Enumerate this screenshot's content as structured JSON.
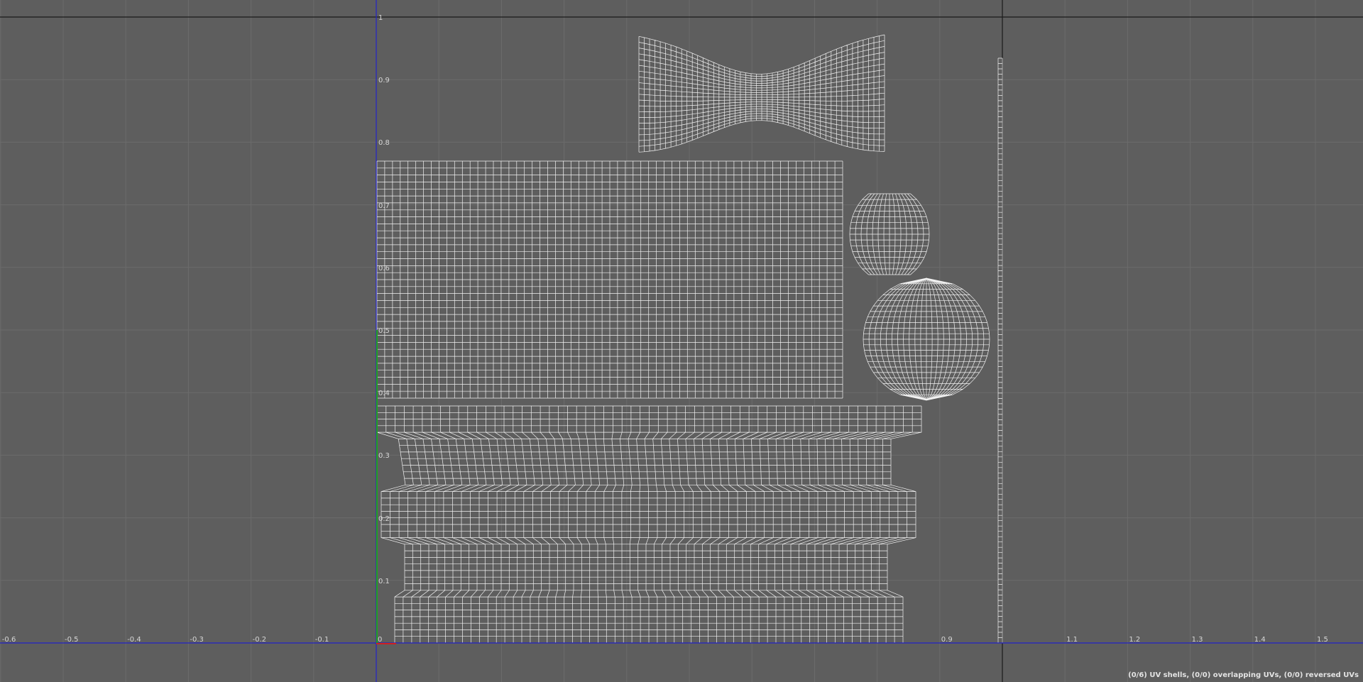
{
  "viewport": {
    "u_labels": [
      "-0.6",
      "-0.5",
      "-0.4",
      "-0.3",
      "-0.2",
      "-0.1",
      "0",
      "0.9",
      "1.1",
      "1.2",
      "1.3",
      "1.4",
      "1.5"
    ],
    "v_labels": [
      "1",
      "0.9",
      "0.8",
      "0.7",
      "0.6",
      "0.5",
      "0.4",
      "0.3",
      "0.2",
      "0.1"
    ],
    "colors": {
      "background": "#5e5e5e",
      "grid": "#6b6b6b",
      "frame": "#1a1a1a",
      "u_axis": "#2323c8",
      "v_axis": "#2323c8",
      "v_highlight": "#22a022",
      "u_highlight": "#d02020",
      "wireframe": "#f2f2f2"
    }
  },
  "uv_shells": [
    {
      "name": "curved-bone-shell"
    },
    {
      "name": "large-rectangle-shell"
    },
    {
      "name": "small-sphere-shell"
    },
    {
      "name": "large-sphere-shell"
    },
    {
      "name": "cylinder-body-shell"
    },
    {
      "name": "thin-strip-shell"
    }
  ],
  "status": {
    "text": "(0/6) UV shells, (0/0) overlapping UVs, (0/0) reversed UVs"
  }
}
